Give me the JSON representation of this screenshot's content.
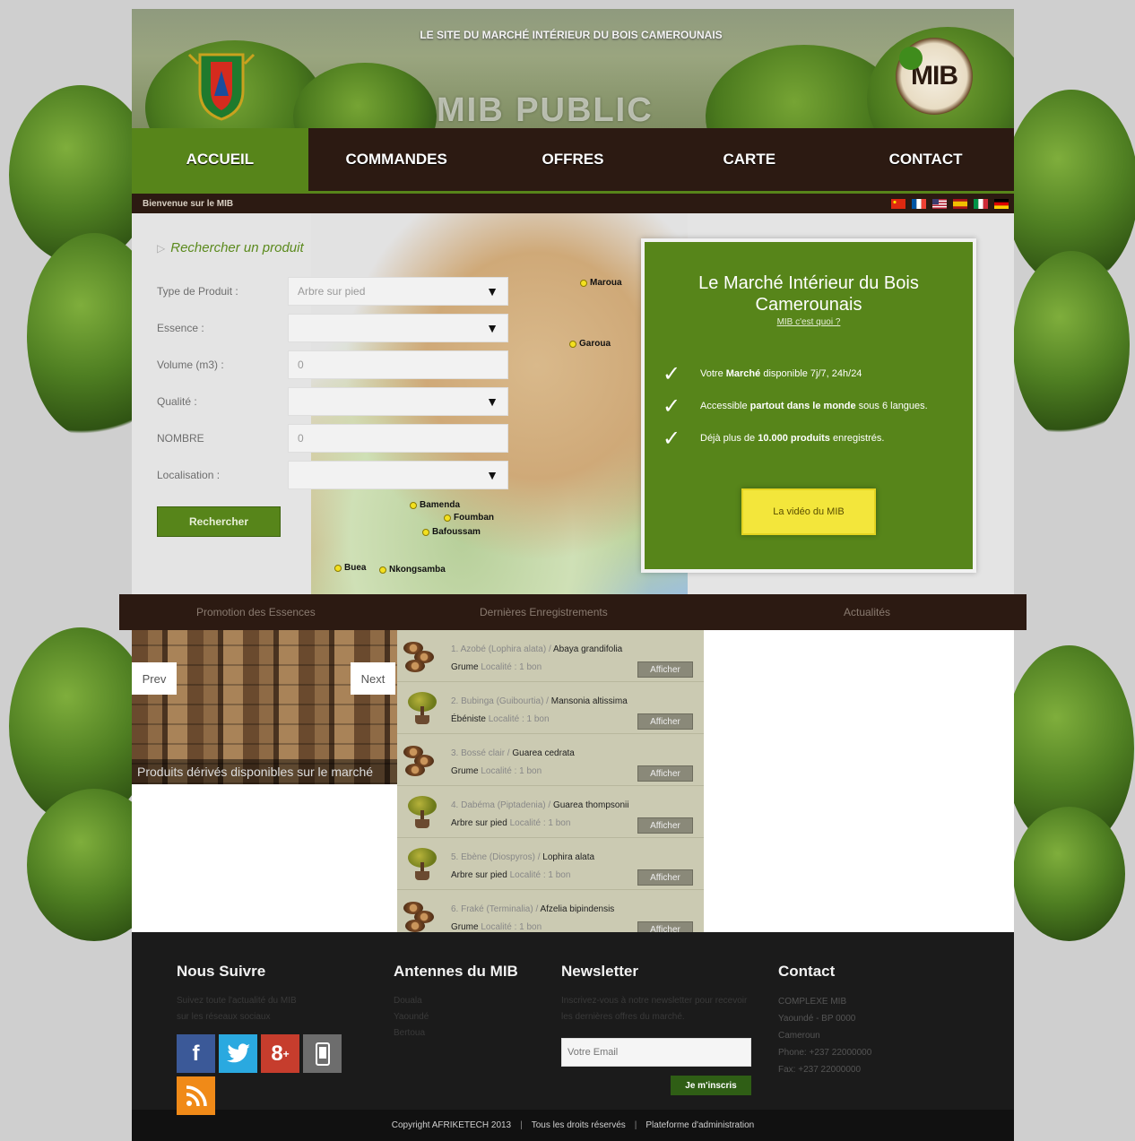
{
  "header": {
    "tagline": "LE SITE DU MARCHÉ INTÉRIEUR DU BOIS CAMEROUNAIS",
    "site_title": "MIB PUBLIC",
    "logo_text": "MIB"
  },
  "nav": {
    "items": [
      {
        "label": "ACCUEIL",
        "active": true
      },
      {
        "label": "COMMANDES",
        "active": false
      },
      {
        "label": "OFFRES",
        "active": false
      },
      {
        "label": "CARTE",
        "active": false
      },
      {
        "label": "CONTACT",
        "active": false
      }
    ]
  },
  "subbar": {
    "credit": "Bienvenue sur le MIB",
    "flags": [
      "cn",
      "fr",
      "us",
      "es",
      "it",
      "de"
    ]
  },
  "search": {
    "title": "Rechercher un produit",
    "fields": [
      {
        "label": "Type de Produit :",
        "value": "Arbre sur pied",
        "kind": "select"
      },
      {
        "label": "Essence :",
        "value": "",
        "kind": "select"
      },
      {
        "label": "Volume (m3) :",
        "value": "0",
        "kind": "input"
      },
      {
        "label": "Qualité :",
        "value": "",
        "kind": "select"
      },
      {
        "label": "NOMBRE",
        "value": "0",
        "kind": "input"
      },
      {
        "label": "Localisation :",
        "value": "",
        "kind": "select"
      }
    ],
    "button": "Rechercher"
  },
  "map": {
    "cities": [
      "Maroua",
      "Garoua",
      "Bamenda",
      "Foumban",
      "Bafoussam",
      "Buea",
      "Nkongsamba"
    ]
  },
  "promo": {
    "title": "Le Marché Intérieur du Bois Camerounais",
    "link": "MIB c'est quoi ?",
    "features": [
      {
        "pre": "Votre ",
        "bold": "Marché",
        "post": " disponible 7j/7, 24h/24"
      },
      {
        "pre": "Accessible ",
        "bold": "partout dans le monde",
        "post": " sous 6 langues."
      },
      {
        "pre": "Déjà plus de ",
        "bold": "10.000 produits",
        "post": " enregistrés."
      }
    ],
    "video_button": "La vidéo du MIB"
  },
  "band": {
    "items": [
      "Promotion des Essences",
      "Dernières Enregistrements",
      "Actualités"
    ]
  },
  "slider": {
    "prev": "Prev",
    "next": "Next",
    "caption": "Produits dérivés disponibles sur le marché"
  },
  "products": [
    {
      "name": "1. Azobé (Lophira alata) / ",
      "kind": "Abaya grandifolia",
      "type": "Grume",
      "meta": "Localité : 1 bon",
      "icon": "logs"
    },
    {
      "name": "2. Bubinga (Guibourtia) / ",
      "kind": "Mansonia altissima",
      "type": "Ébéniste",
      "meta": "Localité : 1 bon",
      "icon": "bonsai"
    },
    {
      "name": "3. Bossé clair / ",
      "kind": "Guarea cedrata",
      "type": "Grume",
      "meta": "Localité : 1 bon",
      "icon": "logs"
    },
    {
      "name": "4. Dabéma (Piptadenia) / ",
      "kind": "Guarea thompsonii",
      "type": "Arbre sur pied",
      "meta": "Localité : 1 bon",
      "icon": "bonsai"
    },
    {
      "name": "5. Ebène (Diospyros) / ",
      "kind": "Lophira alata",
      "type": "Arbre sur pied",
      "meta": "Localité : 1 bon",
      "icon": "bonsai"
    },
    {
      "name": "6. Fraké (Terminalia) / ",
      "kind": "Afzelia bipindensis",
      "type": "Grume",
      "meta": "Localité : 1 bon",
      "icon": "logs"
    }
  ],
  "product_button": "Afficher",
  "footer": {
    "follow": {
      "title": "Nous Suivre",
      "text_lines": [
        "Suivez toute l'actualité du MIB",
        "sur les réseaux sociaux"
      ]
    },
    "antennas": {
      "title": "Antennes du MIB",
      "items": [
        "Douala",
        "Yaoundé",
        "Bertoua"
      ]
    },
    "newsletter": {
      "title": "Newsletter",
      "text": "Inscrivez-vous à notre newsletter pour recevoir les dernières offres du marché.",
      "placeholder": "Votre Email",
      "button": "Je m'inscris"
    },
    "contact": {
      "title": "Contact",
      "lines": [
        "COMPLEXE MIB",
        "Yaoundé - BP 0000",
        "Cameroun",
        "Phone: +237 22000000",
        "Fax: +237 22000000"
      ]
    },
    "copyright": "Copyright AFRIKETECH 2013",
    "rights": "Tous les droits réservés",
    "admin": "Plateforme d'administration"
  }
}
